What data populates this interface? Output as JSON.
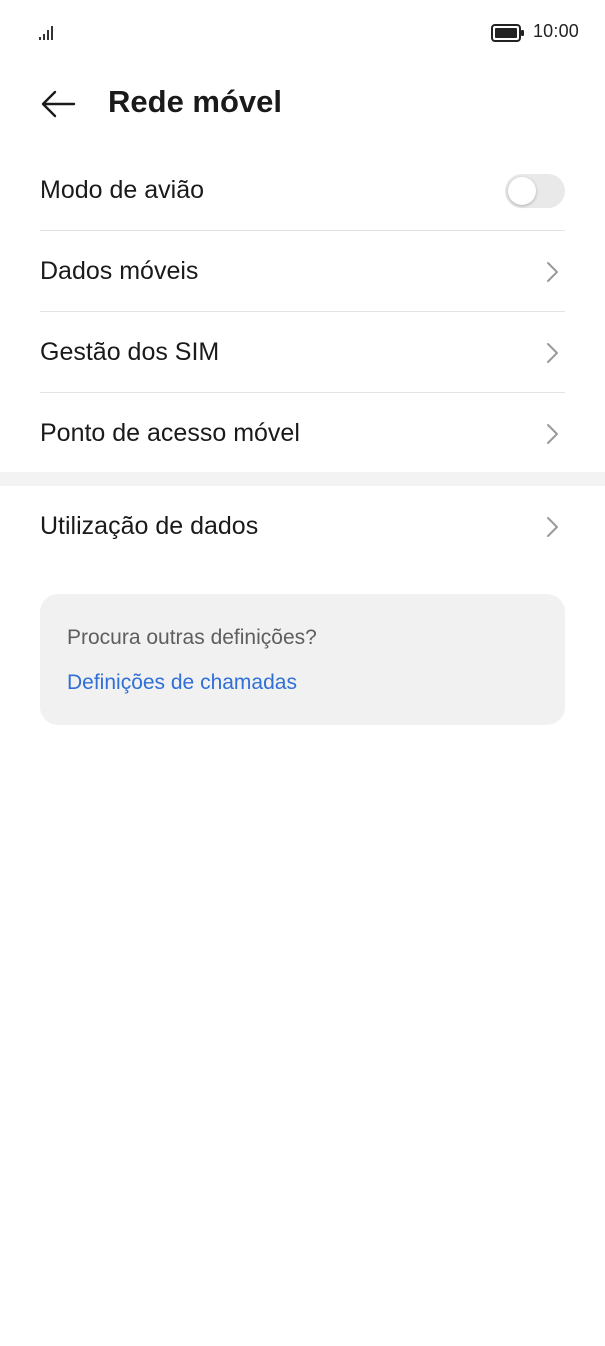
{
  "status_bar": {
    "signal_icon": "signal-bars-icon",
    "battery_icon": "battery-icon",
    "time": "10:00"
  },
  "header": {
    "back_icon": "back-arrow-icon",
    "title": "Rede móvel"
  },
  "settings": {
    "items": [
      {
        "label": "Modo de avião",
        "control": "toggle",
        "toggle_on": false
      },
      {
        "label": "Dados móveis",
        "control": "chevron"
      },
      {
        "label": "Gestão dos SIM",
        "control": "chevron"
      },
      {
        "label": "Ponto de acesso móvel",
        "control": "chevron"
      },
      {
        "label": "Utilização de dados",
        "control": "chevron"
      }
    ]
  },
  "suggestion_card": {
    "question": "Procura outras definições?",
    "link": "Definições de chamadas"
  },
  "colors": {
    "accent_link": "#2f6fd6",
    "toggle_off_track": "#e9e9e9",
    "card_background": "#f1f1f1",
    "divider": "#e3e3e3"
  }
}
